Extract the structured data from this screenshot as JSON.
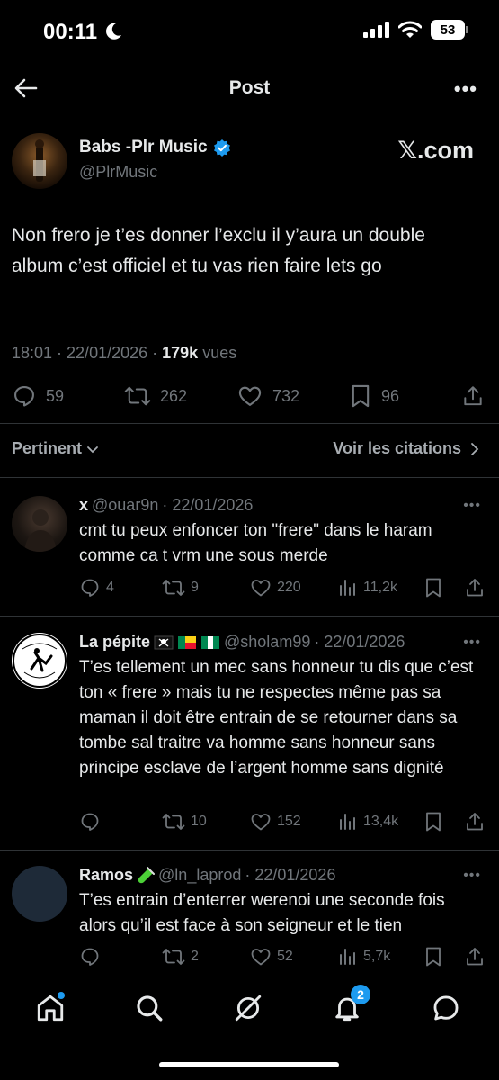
{
  "status_bar": {
    "time": "00:11",
    "battery": "53"
  },
  "nav": {
    "title": "Post"
  },
  "post": {
    "author_name": "Babs -Plr Music",
    "author_handle": "@PlrMusic",
    "source_label": "𝕏.com",
    "text": "Non frero je t’es donner l’exclu il y’aura un double album c’est officiel et tu vas rien faire lets go",
    "time": "18:01 · 22/01/2026 ·",
    "views_count": "179k",
    "views_label": "vues",
    "replies": "59",
    "reposts": "262",
    "likes": "732",
    "bookmarks": "96"
  },
  "sort": {
    "left_label": "Pertinent",
    "right_label": "Voir les citations"
  },
  "replies": [
    {
      "name": "x",
      "handle": "@ouar9n",
      "date": "· 22/01/2026",
      "text": "cmt tu peux enfoncer ton \"frere\" dans le haram comme ca t vrm une sous merde",
      "replies": "4",
      "reposts": "9",
      "likes": "220",
      "views": "11,2k"
    },
    {
      "name": "La pépite",
      "handle": "@sholam99",
      "date": "· 22/01/2026",
      "avatar_text": "MAKE RACISTS AFRAID AGAIN",
      "text": "T’es tellement un mec sans honneur tu dis que c’est ton « frere » mais tu ne respectes même pas sa maman il doit être entrain de se retourner dans sa tombe sal traitre va homme sans honneur sans principe esclave de l’argent homme sans dignité",
      "replies": "",
      "reposts": "10",
      "likes": "152",
      "views": "13,4k"
    },
    {
      "name": "Ramos",
      "handle": "@ln_laprod",
      "date": "· 22/01/2026",
      "text": "T’es entrain d’enterrer werenoi une seconde fois alors qu’il est face à son seigneur et le tien",
      "replies": "",
      "reposts": "2",
      "likes": "52",
      "views": "5,7k"
    }
  ],
  "tabbar": {
    "notifications_badge": "2"
  },
  "colors": {
    "accent": "#1d9bf0",
    "muted": "#71767b",
    "text": "#e7e9ea",
    "background": "#000000"
  }
}
